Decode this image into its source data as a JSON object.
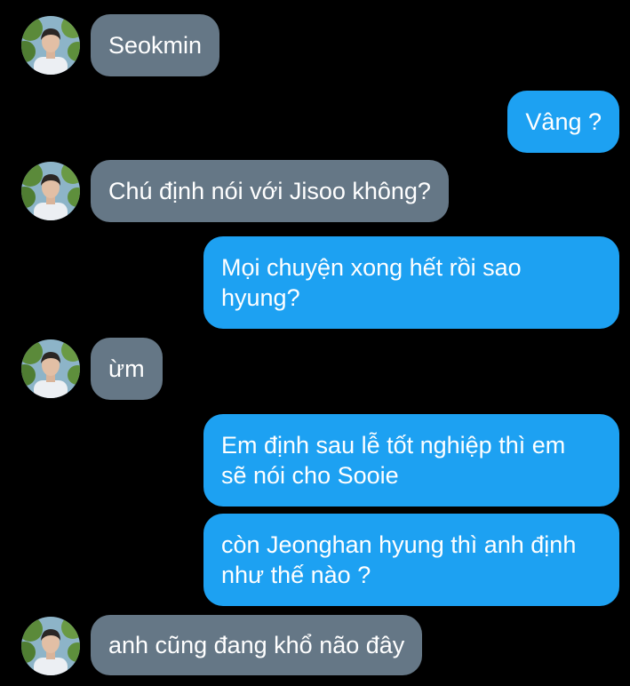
{
  "colors": {
    "background": "#000000",
    "incoming_bubble": "#657786",
    "outgoing_bubble": "#1da1f2",
    "text": "#ffffff"
  },
  "contact": {
    "avatar_icon": "profile-photo-icon"
  },
  "messages": [
    {
      "direction": "incoming",
      "text": "Seokmin"
    },
    {
      "direction": "outgoing",
      "text": "Vâng ?"
    },
    {
      "direction": "incoming",
      "text": "Chú định nói với Jisoo không?"
    },
    {
      "direction": "outgoing",
      "lines": [
        "Mọi chuyện xong hết rồi sao",
        "hyung?"
      ]
    },
    {
      "direction": "incoming",
      "text": "ừm"
    },
    {
      "direction": "outgoing",
      "lines": [
        "Em định sau lễ tốt nghiệp thì em",
        "sẽ nói cho Sooie"
      ]
    },
    {
      "direction": "outgoing",
      "lines": [
        "còn Jeonghan hyung thì anh định",
        "như thế nào ?"
      ]
    },
    {
      "direction": "incoming",
      "text": "anh cũng đang khổ não đây"
    }
  ]
}
